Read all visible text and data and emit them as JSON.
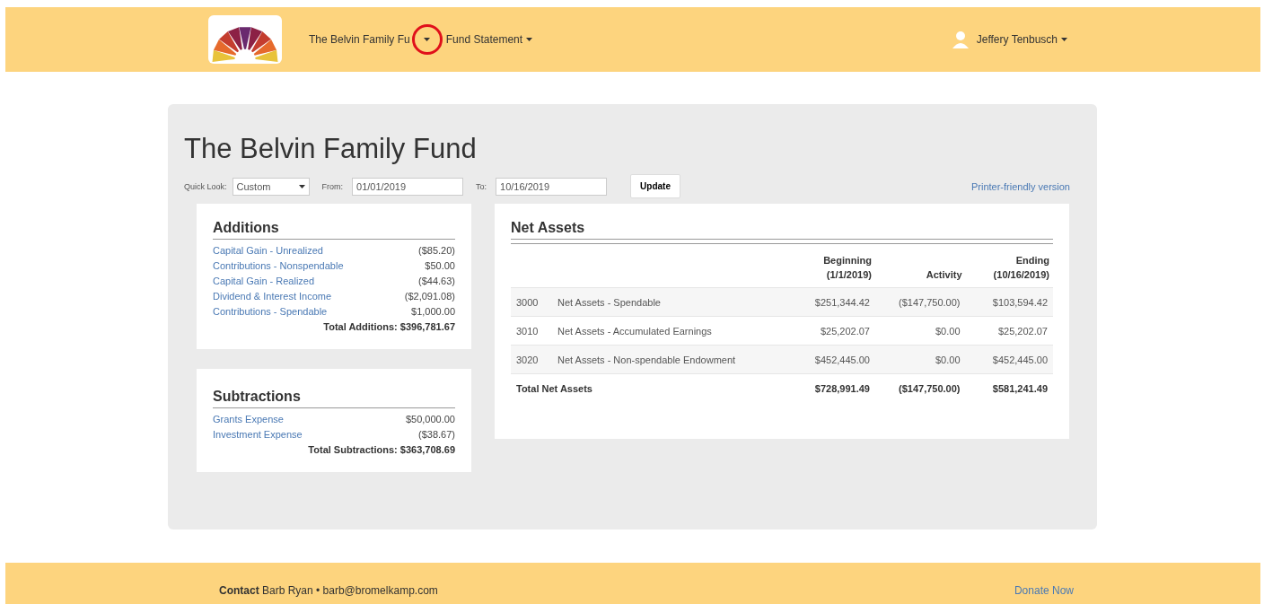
{
  "nav": {
    "fund_menu": "The Belvin Family Fu",
    "report_menu": "Fund Statement",
    "user_menu": "Jeffery Tenbusch"
  },
  "title": "The Belvin Family Fund",
  "filters": {
    "quick_look_label": "Quick Look:",
    "quick_look_value": "Custom",
    "from_label": "From:",
    "from_value": "01/01/2019",
    "to_label": "To:",
    "to_value": "10/16/2019",
    "update_button": "Update",
    "printer_link": "Printer-friendly version"
  },
  "additions": {
    "heading": "Additions",
    "items": [
      {
        "label": "Capital Gain - Unrealized",
        "amount": "($85.20)"
      },
      {
        "label": "Contributions - Nonspendable",
        "amount": "$50.00"
      },
      {
        "label": "Capital Gain - Realized",
        "amount": "($44.63)"
      },
      {
        "label": "Dividend & Interest Income",
        "amount": "($2,091.08)"
      },
      {
        "label": "Contributions - Spendable",
        "amount": "$1,000.00"
      }
    ],
    "total": "Total Additions: $396,781.67"
  },
  "subtractions": {
    "heading": "Subtractions",
    "items": [
      {
        "label": "Grants Expense",
        "amount": "$50,000.00"
      },
      {
        "label": "Investment Expense",
        "amount": "($38.67)"
      }
    ],
    "total": "Total Subtractions: $363,708.69"
  },
  "net_assets": {
    "heading": "Net Assets",
    "columns": [
      "Beginning (1/1/2019)",
      "Activity",
      "Ending (10/16/2019)"
    ],
    "rows": [
      {
        "code": "3000",
        "name": "Net Assets - Spendable",
        "beginning": "$251,344.42",
        "activity": "($147,750.00)",
        "ending": "$103,594.42"
      },
      {
        "code": "3010",
        "name": "Net Assets - Accumulated Earnings",
        "beginning": "$25,202.07",
        "activity": "$0.00",
        "ending": "$25,202.07"
      },
      {
        "code": "3020",
        "name": "Net Assets - Non-spendable Endowment",
        "beginning": "$452,445.00",
        "activity": "$0.00",
        "ending": "$452,445.00"
      }
    ],
    "total": {
      "label": "Total Net Assets",
      "beginning": "$728,991.49",
      "activity": "($147,750.00)",
      "ending": "$581,241.49"
    }
  },
  "footer": {
    "contact_label": "Contact",
    "contact_text": "Barb Ryan • barb@bromelkamp.com",
    "donate_link": "Donate Now"
  }
}
